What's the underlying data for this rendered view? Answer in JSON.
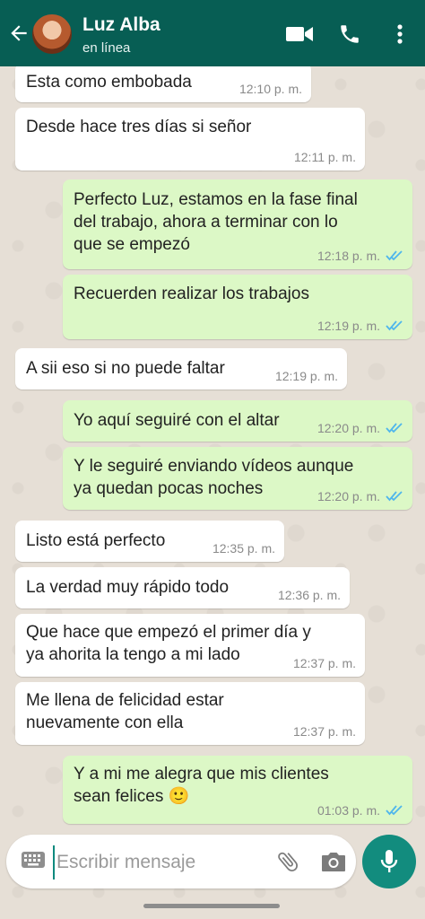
{
  "header": {
    "contact_name": "Luz Alba",
    "status": "en línea",
    "icons": [
      "back-arrow-icon",
      "video-call-icon",
      "phone-icon",
      "more-options-icon"
    ]
  },
  "messages": [
    {
      "direction": "incoming",
      "text": "Esta como embobada",
      "time": "12:10 p. m."
    },
    {
      "direction": "incoming",
      "text": "Desde hace tres días si señor",
      "time": "12:11 p. m."
    },
    {
      "direction": "outgoing",
      "text": "Perfecto Luz, estamos en la fase final\ndel trabajo, ahora a terminar con lo\nque se empezó",
      "time": "12:18 p. m.",
      "read": true
    },
    {
      "direction": "outgoing",
      "text": "Recuerden realizar los trabajos",
      "time": "12:19 p. m.",
      "read": true
    },
    {
      "direction": "incoming",
      "text": "A sii eso si no puede faltar",
      "time": "12:19 p. m."
    },
    {
      "direction": "outgoing",
      "text": "Yo aquí seguiré con el altar",
      "time": "12:20 p. m.",
      "read": true
    },
    {
      "direction": "outgoing",
      "text": "Y le seguiré enviando vídeos aunque\nya quedan pocas noches",
      "time": "12:20 p. m.",
      "read": true
    },
    {
      "direction": "incoming",
      "text": "Listo está perfecto",
      "time": "12:35 p. m."
    },
    {
      "direction": "incoming",
      "text": "La verdad muy rápido todo",
      "time": "12:36 p. m."
    },
    {
      "direction": "incoming",
      "text": "Que hace que empezó el primer día y\nya ahorita la tengo a mi lado",
      "time": "12:37 p. m."
    },
    {
      "direction": "incoming",
      "text": "Me llena de felicidad estar\nnuevamente con ella",
      "time": "12:37 p. m."
    },
    {
      "direction": "outgoing",
      "text": "Y a mi me alegra que mis clientes\nsean felices 🙂",
      "time": "01:03 p. m.",
      "read": true
    }
  ],
  "composer": {
    "placeholder": "Escribir mensaje",
    "value": ""
  },
  "colors": {
    "header": "#075e54",
    "outgoing_bubble": "#dcf8c6",
    "incoming_bubble": "#ffffff",
    "read_ticks": "#4fb6ec",
    "mic_button": "#128c7e"
  }
}
